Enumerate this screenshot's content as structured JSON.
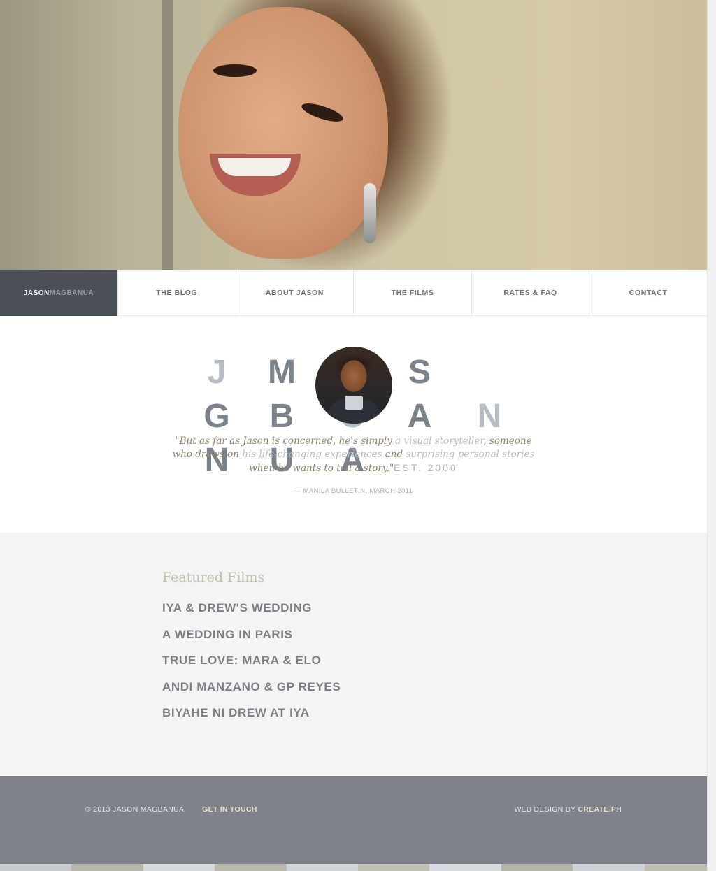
{
  "nav": {
    "brand_first": "JASON",
    "brand_last": "MAGBANUA",
    "items": [
      "THE BLOG",
      "ABOUT JASON",
      "THE FILMS",
      "RATES & FAQ",
      "CONTACT"
    ]
  },
  "intro": {
    "letters": [
      "J",
      "M",
      "A",
      "S",
      "G",
      "B",
      "O",
      "A",
      "N",
      "N",
      "U",
      "A"
    ],
    "quote_1": "\"But as far as Jason is concerned, he's simply ",
    "quote_hl_1": "a visual storyteller",
    "quote_2": ", someone who draws on ",
    "quote_hl_2": "his life-changing experiences",
    "quote_3": " and ",
    "quote_hl_3": "surprising personal stories",
    "quote_4": " when he wants to tell a story.\"",
    "est": "EST. 2000",
    "cite": "— MANILA BULLETIN, MARCH 2011"
  },
  "featured": {
    "heading": "Featured Films",
    "films": [
      "IYA & DREW'S WEDDING",
      "A WEDDING IN PARIS",
      "TRUE LOVE: MARA & ELO",
      "ANDI MANZANO & GP REYES",
      "BIYAHE NI DREW AT IYA"
    ]
  },
  "footer": {
    "copyright": "© 2013 JASON MAGBANUA",
    "get_in_touch": "GET IN TOUCH",
    "credit_prefix": "WEB DESIGN BY ",
    "credit_name": "CREATE.PH"
  },
  "colors": {
    "nav_brand_bg": "#4b4f57",
    "footer_bg": "#7d828b",
    "accent_gold": "#c9bfa9",
    "text_slate": "#7a808a"
  },
  "stripe_colors": [
    "#c6cacf",
    "#b9b6ab",
    "#d3d8dd",
    "#bdb9ad",
    "#cfd4d9",
    "#c2beb2",
    "#d6dade",
    "#b7b3a7",
    "#ccd1d6",
    "#c0bcb0"
  ]
}
